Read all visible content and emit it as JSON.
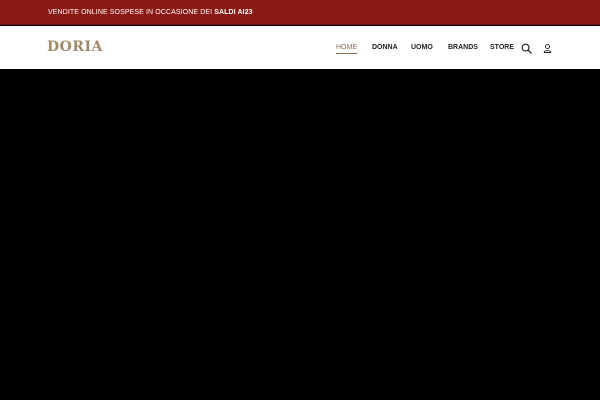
{
  "announcement": {
    "text": "VENDITE ONLINE SOSPESE IN OCCASIONE DEI ",
    "highlight": "SALDI AI23"
  },
  "header": {
    "logo": "DORIA",
    "nav": [
      {
        "label": "HOME",
        "active": true
      },
      {
        "label": "DONNA",
        "active": false
      },
      {
        "label": "UOMO",
        "active": false
      },
      {
        "label": "BRANDS",
        "active": false
      },
      {
        "label": "STORE",
        "active": false
      }
    ],
    "icons": [
      "search-icon",
      "user-icon"
    ]
  },
  "colors": {
    "announce_bg": "#8b1a14",
    "logo": "#a08a6c",
    "active_nav": "#8b6a55",
    "hero_bg": "#000000"
  }
}
